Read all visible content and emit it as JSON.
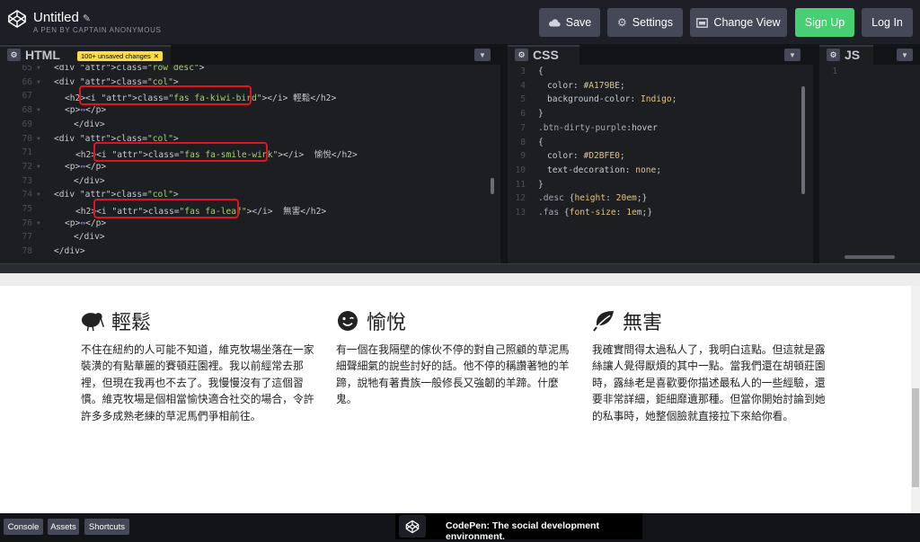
{
  "header": {
    "title": "Untitled",
    "pencil": "✎",
    "subtitle": "A PEN BY CAPTAIN ANONYMOUS",
    "buttons": {
      "save": "Save",
      "settings": "Settings",
      "change_view": "Change View",
      "signup": "Sign Up",
      "login": "Log In"
    }
  },
  "editors": {
    "html": {
      "label": "HTML",
      "badge": "100+ unsaved changes",
      "lines": [
        {
          "n": "65",
          "text": "<div class=\"row desc\">"
        },
        {
          "n": "66",
          "text": "<div class=\"col\">"
        },
        {
          "n": "67",
          "text": "<h2><i class=\"fas fa-kiwi-bird\"></i> 輕鬆</h2>"
        },
        {
          "n": "68",
          "text": "<p>⇔</p>"
        },
        {
          "n": "69",
          "text": "</div>"
        },
        {
          "n": "70",
          "text": "<div class=\"col\">"
        },
        {
          "n": "71",
          "text": "<h2><i class=\"fas fa-smile-wink\"></i>  愉悅</h2>"
        },
        {
          "n": "72",
          "text": "<p>⇔</p>"
        },
        {
          "n": "73",
          "text": "</div>"
        },
        {
          "n": "74",
          "text": "<div class=\"col\">"
        },
        {
          "n": "75",
          "text": "<h2><i class=\"fas fa-leaf\"></i>  無害</h2>"
        },
        {
          "n": "76",
          "text": "<p>⇔</p>"
        },
        {
          "n": "77",
          "text": "</div>"
        },
        {
          "n": "78",
          "text": "</div>"
        }
      ]
    },
    "css": {
      "label": "CSS",
      "lines": [
        {
          "n": "3",
          "text": "{"
        },
        {
          "n": "4",
          "text": "color: #A179BE;"
        },
        {
          "n": "5",
          "text": "background-color: Indigo;"
        },
        {
          "n": "6",
          "text": "}"
        },
        {
          "n": "7",
          "text": ".btn-dirty-purple:hover"
        },
        {
          "n": "8",
          "text": "{"
        },
        {
          "n": "9",
          "text": "color: #D2BFE0;"
        },
        {
          "n": "10",
          "text": "text-decoration: none;"
        },
        {
          "n": "11",
          "text": "}"
        },
        {
          "n": "12",
          "text": ".desc {height: 20em;}"
        },
        {
          "n": "13",
          "text": ".fas {font-size: 1em;}"
        }
      ]
    },
    "js": {
      "label": "JS",
      "lines": [
        {
          "n": "1",
          "text": ""
        }
      ]
    }
  },
  "preview": {
    "columns": [
      {
        "icon": "kiwi-bird-icon",
        "heading": "輕鬆",
        "body": "不住在紐約的人可能不知道，維克牧場坐落在一家裝潢的有點華麗的賽頓莊園裡。我以前經常去那裡，但現在我再也不去了。我慢慢沒有了這個習慣。維克牧場是個相當愉快適合社交的場合，令許許多多成熟老練的草泥馬們爭相前往。"
      },
      {
        "icon": "smile-wink-icon",
        "heading": "愉悅",
        "body": "有一個在我隔壁的傢伙不停的對自己照顧的草泥馬細聲細氣的說些討好的話。他不停的稱讚著牠的羊蹄，說牠有著貴族一般修長又強韌的羊蹄。什麼鬼。"
      },
      {
        "icon": "leaf-icon",
        "heading": "無害",
        "body": "我確實問得太過私人了，我明白這點。但這就是露絲讓人覺得厭煩的其中一點。當我們還在胡頓莊園時，露絲老是喜歡要你描述最私人的一些經驗，還要非常詳細，鉅細靡遺那種。但當你開始討論到她的私事時，她整個臉就直接拉下來給你看。"
      }
    ]
  },
  "footer": {
    "console": "Console",
    "assets": "Assets",
    "shortcuts": "Shortcuts",
    "promo": "CodePen: The social development environment."
  },
  "colors": {
    "signup": "#47cf73",
    "highlight": "#e0141e",
    "badge": "#ffdd40"
  }
}
